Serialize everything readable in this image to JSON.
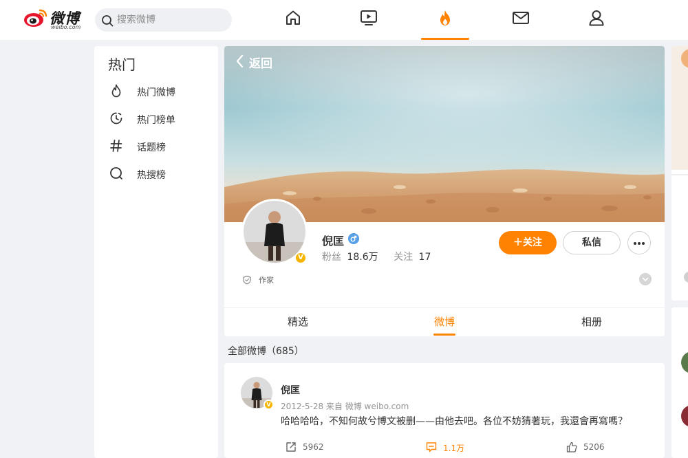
{
  "app": {
    "brand": "微博",
    "brand_sub": "weibo.com"
  },
  "search": {
    "placeholder": "搜索微博"
  },
  "nav": {
    "icons": [
      "home-icon",
      "video-icon",
      "hot-icon",
      "mail-icon",
      "user-icon"
    ],
    "active": "hot-icon"
  },
  "sidebar": {
    "title": "热门",
    "items": [
      {
        "label": "热门微博",
        "icon": "fire-icon"
      },
      {
        "label": "热门榜单",
        "icon": "clock-icon"
      },
      {
        "label": "话题榜",
        "icon": "hashtag-icon"
      },
      {
        "label": "热搜榜",
        "icon": "search-circle-icon"
      }
    ]
  },
  "profile": {
    "back_label": "返回",
    "name": "倪匡",
    "fans_label": "粉丝",
    "fans_count": "18.6万",
    "follow_label": "关注",
    "follow_count": "17",
    "follow_button": "关注",
    "message_button": "私信",
    "tagline": "作家",
    "verified_badge": "V"
  },
  "tabs": [
    {
      "label": "精选"
    },
    {
      "label": "微博"
    },
    {
      "label": "相册"
    }
  ],
  "active_tab": "微博",
  "feed": {
    "count_label": "全部微博（685）",
    "post": {
      "author": "倪匡",
      "meta": "2012-5-28  来自 微博 weibo.com",
      "text": "哈哈哈哈，不知何故兮博文被删——由他去吧。各位不妨猜著玩，我還會再寫嗎？",
      "reposts": "5962",
      "comments": "1.1万",
      "likes": "5206"
    }
  },
  "colors": {
    "accent": "#ff8200",
    "verified": "#f5b400",
    "gender": "#5aa0e6",
    "page_bg": "#f1f2f5"
  }
}
